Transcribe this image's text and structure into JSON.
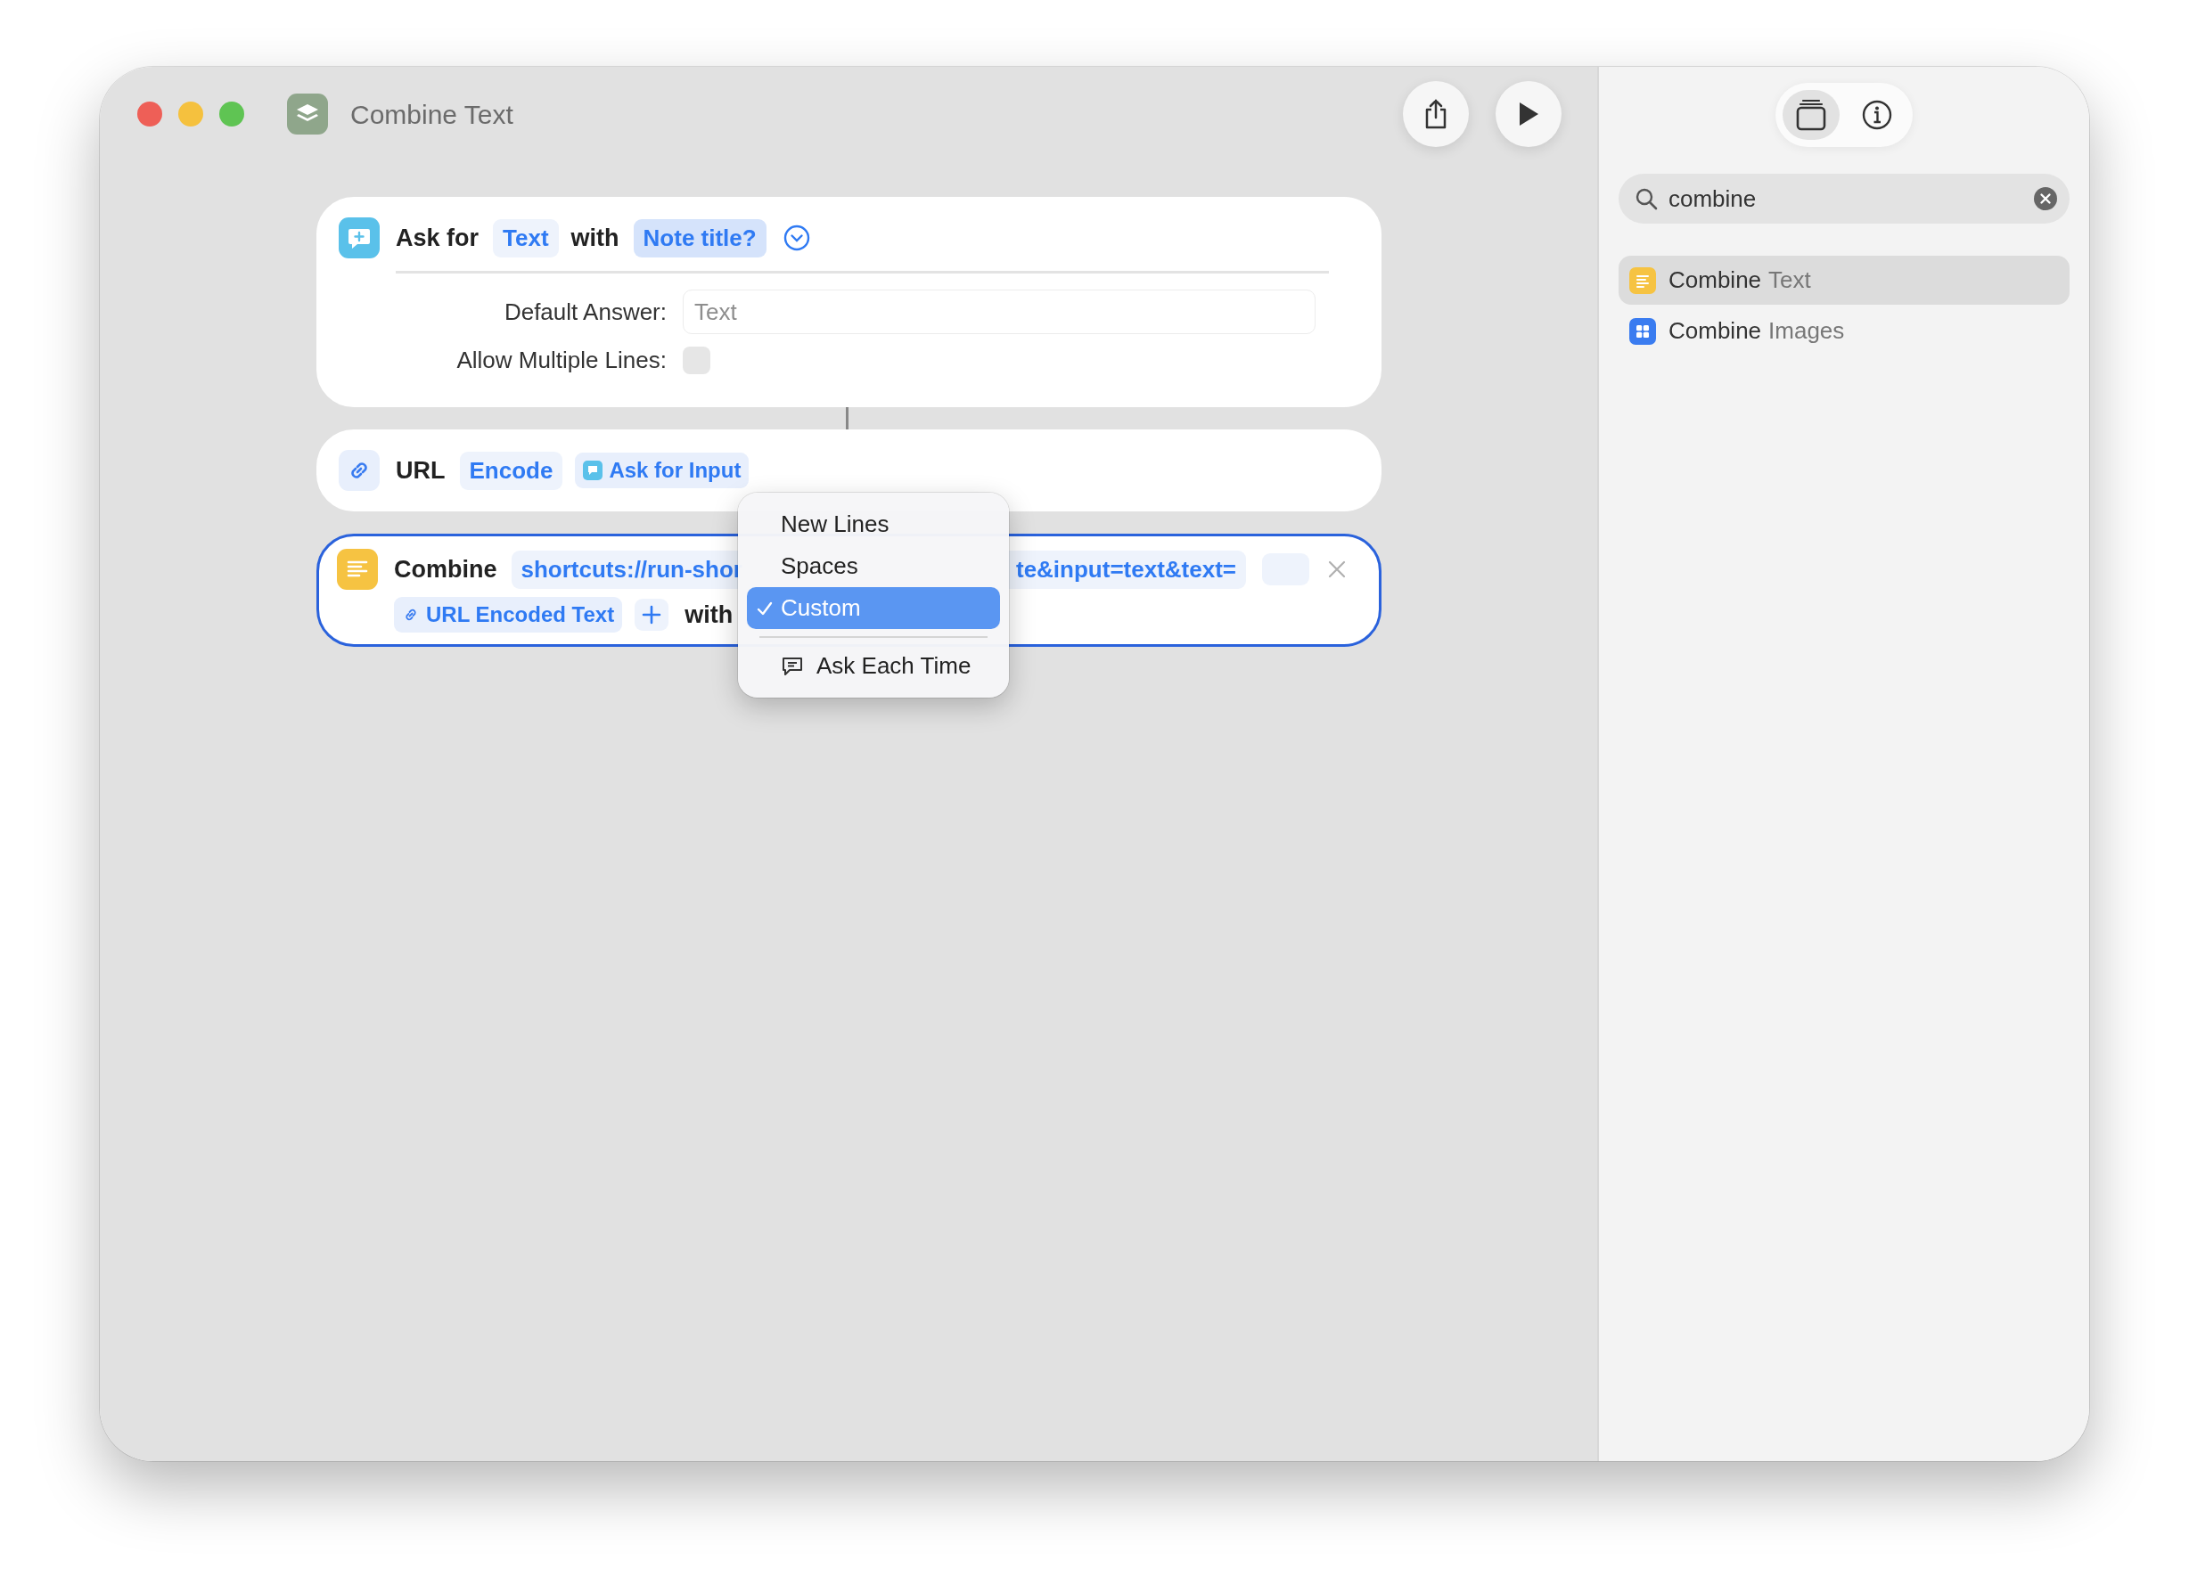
{
  "window": {
    "title": "Combine Text"
  },
  "toolbar": {
    "buttons": [
      {
        "kind": "share"
      },
      {
        "kind": "run"
      }
    ]
  },
  "actions": [
    {
      "kind": "ask",
      "selected": false,
      "lines": [
        [
          {
            "kind": "label",
            "text": "Ask for"
          },
          {
            "kind": "token",
            "text": "Text"
          },
          {
            "kind": "label",
            "text": "with"
          },
          {
            "kind": "variable",
            "text": "Note title?"
          },
          {
            "kind": "expand"
          }
        ]
      ],
      "fields": [
        {
          "kind": "text",
          "label": "Default Answer:",
          "placeholder": "Text"
        },
        {
          "kind": "checkbox",
          "label": "Allow Multiple Lines:",
          "checked": false
        }
      ]
    },
    {
      "kind": "url",
      "selected": false,
      "lines": [
        [
          {
            "kind": "label",
            "text": "URL"
          },
          {
            "kind": "token",
            "text": "Encode"
          },
          {
            "kind": "askvariable",
            "text": "Ask for Input"
          }
        ]
      ]
    },
    {
      "kind": "combine",
      "selected": true,
      "lines": [
        [
          {
            "kind": "label",
            "text": "Combine"
          },
          {
            "kind": "token",
            "segments": [
              "shortcuts://run-shor",
              "te&input=text&text="
            ]
          },
          {
            "kind": "empty"
          },
          {
            "kind": "close"
          }
        ],
        [
          {
            "kind": "linkvariable",
            "text": "URL Encoded Text"
          },
          {
            "kind": "add"
          },
          {
            "kind": "label",
            "text": "with"
          }
        ]
      ]
    }
  ],
  "menu": {
    "items": [
      {
        "kind": "option",
        "label": "New Lines",
        "checked": false,
        "selected": false
      },
      {
        "kind": "option",
        "label": "Spaces",
        "checked": false,
        "selected": false
      },
      {
        "kind": "option",
        "label": "Custom",
        "checked": true,
        "selected": true
      },
      {
        "kind": "separator"
      },
      {
        "kind": "ask",
        "label": "Ask Each Time",
        "checked": false,
        "selected": false
      }
    ]
  },
  "sidebar": {
    "tabs": [
      {
        "kind": "library",
        "selected": true
      },
      {
        "kind": "info",
        "selected": false
      }
    ],
    "search": {
      "value": "combine"
    },
    "results": [
      {
        "kind": "text",
        "match": "Combine",
        "rest": "Text",
        "selected": true
      },
      {
        "kind": "images",
        "match": "Combine",
        "rest": "Images",
        "selected": false
      }
    ]
  }
}
